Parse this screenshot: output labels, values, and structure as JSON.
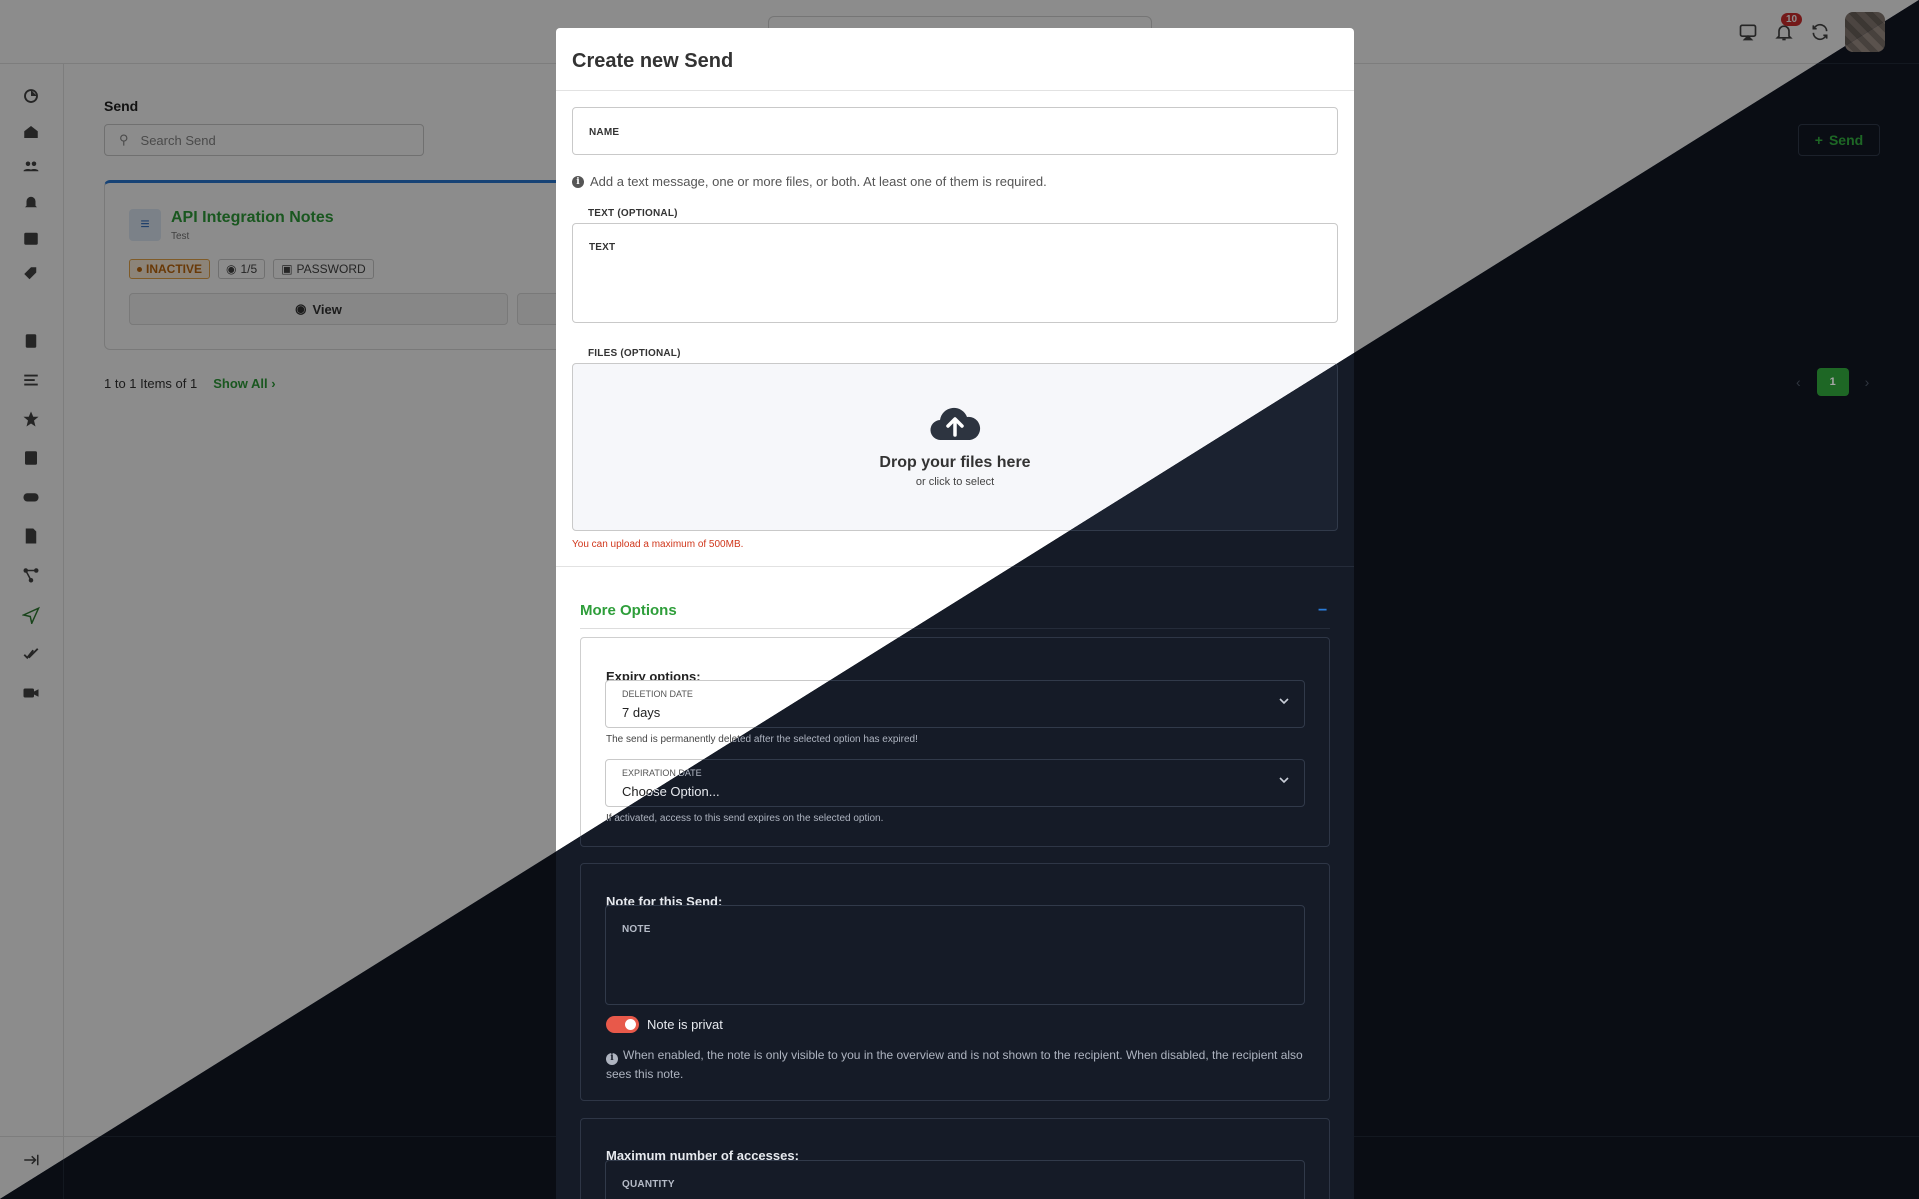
{
  "app": {
    "notifications_count": "10",
    "page_title": "Send",
    "search_placeholder": "Search Send",
    "new_send_label": "Send",
    "card": {
      "title": "API Integration Notes",
      "subtitle": "Test",
      "status": "INACTIVE",
      "views": "1/5",
      "protection": "PASSWORD",
      "view_label": "View"
    },
    "items_text": "1 to 1 Items of 1",
    "show_all": "Show All",
    "current_page": "1",
    "sidebar_icons": [
      "dashboard-icon",
      "home-icon",
      "users-icon",
      "bell-icon",
      "calendar-icon",
      "tags-icon",
      "book-icon",
      "list-icon",
      "star-icon",
      "document-icon",
      "gamepad-icon",
      "pdf-icon",
      "workflow-icon",
      "send-icon",
      "checks-icon",
      "video-icon"
    ],
    "accent": "#2e9e3a"
  },
  "modal": {
    "title": "Create new Send",
    "name_label": "NAME",
    "info_text": "Add a text message, one or more files, or both. At least one of them is required.",
    "text_section_label": "TEXT (OPTIONAL)",
    "text_field_label": "TEXT",
    "files_section_label": "FILES (OPTIONAL)",
    "drop_title": "Drop your files here",
    "drop_sub": "or click to select",
    "upload_hint": "You can upload a maximum of 500MB.",
    "more_options": "More Options",
    "more_toggle": "−",
    "expiry": {
      "title": "Expiry options:",
      "deletion_label": "DELETION DATE",
      "deletion_value": "7 days",
      "deletion_hint": "The send is permanently deleted after the selected option has expired!",
      "expiration_label": "EXPIRATION DATE",
      "expiration_value": "Choose Option...",
      "expiration_hint": "If activated, access to this send expires on the selected option."
    },
    "note": {
      "title": "Note for this Send:",
      "field_label": "NOTE",
      "toggle_label": "Note is privat",
      "toggle_on": true,
      "info": "When enabled, the note is only visible to you in the overview and is not shown to the recipient. When disabled, the recipient also sees this note."
    },
    "max_access": {
      "title": "Maximum number of accesses:",
      "field_label": "QUANTITY"
    }
  }
}
